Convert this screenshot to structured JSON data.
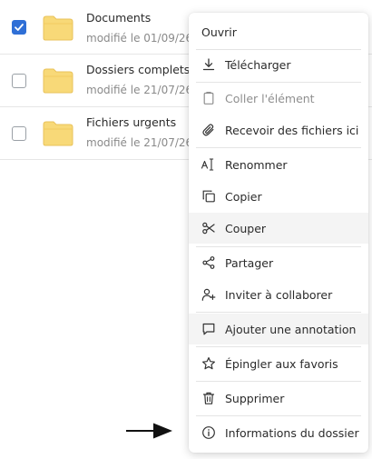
{
  "files": [
    {
      "name": "Documents",
      "meta": "modifié le 01/09/26",
      "checked": true
    },
    {
      "name": "Dossiers complets",
      "meta": "modifié le 21/07/26",
      "checked": false
    },
    {
      "name": "Fichiers urgents",
      "meta": "modifié le 21/07/26",
      "checked": false
    }
  ],
  "menu": {
    "open": "Ouvrir",
    "download": "Télécharger",
    "paste": "Coller l'élément",
    "receive": "Recevoir des fichiers ici",
    "rename": "Renommer",
    "copy": "Copier",
    "cut": "Couper",
    "share": "Partager",
    "invite": "Inviter à collaborer",
    "annotate": "Ajouter une annotation",
    "pin": "Épingler aux favoris",
    "delete": "Supprimer",
    "info": "Informations du dossier"
  },
  "colors": {
    "checkbox_accent": "#2f6fd6",
    "folder": "#f8d978"
  }
}
